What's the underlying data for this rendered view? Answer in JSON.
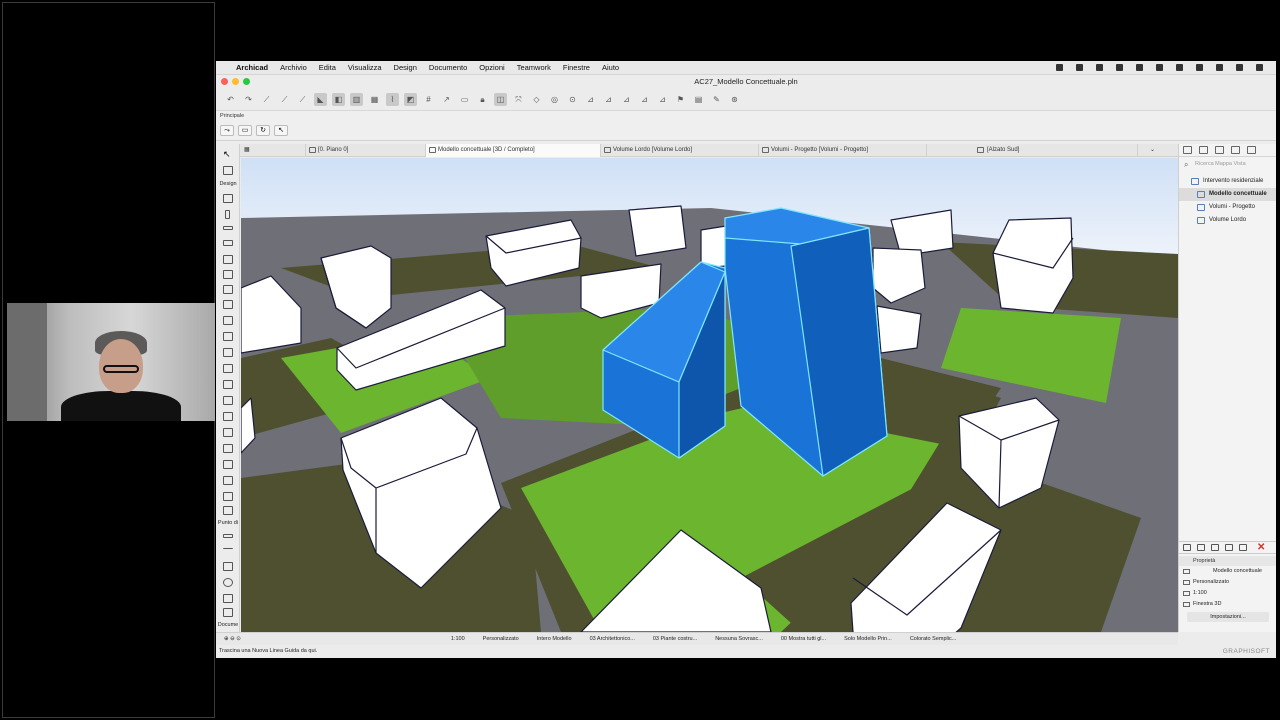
{
  "menubar": {
    "app": "Archicad",
    "items": [
      "Archivio",
      "Edita",
      "Visualizza",
      "Design",
      "Documento",
      "Opzioni",
      "Teamwork",
      "Finestre",
      "Aiuto"
    ]
  },
  "window": {
    "title": "AC27_Modello Concettuale.pln"
  },
  "info_box": {
    "label": "Principale"
  },
  "tabs": [
    {
      "label": "[0. Piano 0]"
    },
    {
      "label": "Modello concettuale [3D / Completo]"
    },
    {
      "label": "Volume Lordo [Volume Lordo]"
    },
    {
      "label": "Volumi - Progetto [Volumi - Progetto]"
    },
    {
      "label": "[Alzato Sud]"
    }
  ],
  "toolbox": {
    "design_label": "Design",
    "viewpoint_label": "Punto di",
    "document_label": "Docume"
  },
  "navigator": {
    "search_placeholder": "Ricerca Mappa Vista",
    "root": "Intervento residenziale",
    "items": [
      "Modello concettuale",
      "Volumi - Progetto",
      "Volume Lordo"
    ]
  },
  "properties": {
    "header": "Proprietà",
    "name": "Modello concettuale",
    "rows": [
      "Personalizzato",
      "1:100",
      "Finestra 3D"
    ],
    "settings_button": "Impostazioni..."
  },
  "statusbar": {
    "scale": "1:100",
    "items": [
      "Personalizzato",
      "Intero Modello",
      "03 Architettonico...",
      "03 Piante costru...",
      "Nessuna Sovrasc...",
      "00 Mostra tutti gl...",
      "Solo Modello Prin...",
      "Colorato Semplic..."
    ]
  },
  "hint": "Trascina una Nuova Linea Guida da qui.",
  "brand": "GRAPHISOFT",
  "colors": {
    "selected_volume": "#1a73d6",
    "grass": "#6cb52e",
    "plot": "#4f5030",
    "road": "#6f7077"
  }
}
